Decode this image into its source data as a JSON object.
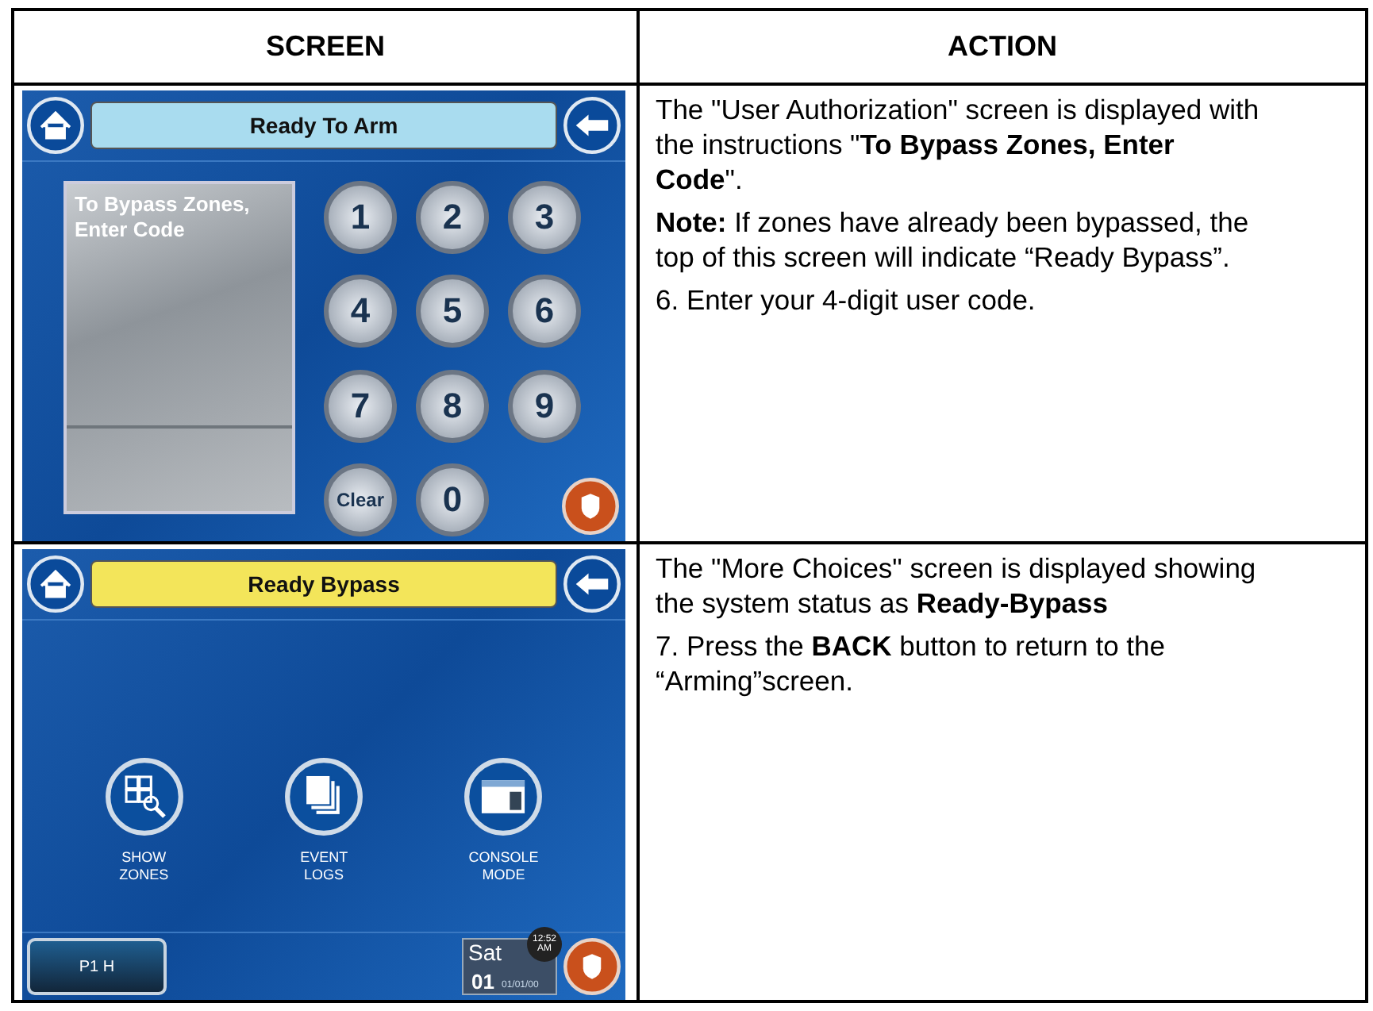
{
  "table": {
    "columns": [
      "SCREEN",
      "ACTION"
    ],
    "rows": [
      {
        "screen": {
          "kind": "keypad",
          "title": "Ready To Arm",
          "bypassed": false,
          "prompt": "To Bypass Zones, Enter Code",
          "keys": [
            "1",
            "2",
            "3",
            "4",
            "5",
            "6",
            "7",
            "8",
            "9",
            "Clear",
            "0"
          ]
        },
        "action": [
          "The \"User Authorization\" screen is displayed with the instructions \"**To Bypass Zones, Enter Code**\".",
          "**Note:** If zones have already been bypassed, the top of this screen will indicate “Ready Bypass”.",
          "6.  Enter your 4-digit user code."
        ]
      },
      {
        "screen": {
          "kind": "menu",
          "title": "Ready Bypass",
          "bypassed": true,
          "options": [
            {
              "kind": "zones",
              "label": "SHOW ZONES"
            },
            {
              "kind": "logs",
              "label": "EVENT LOGS"
            },
            {
              "kind": "console",
              "label": "CONSOLE MODE"
            }
          ],
          "partition": "P1 H",
          "day": "Sat",
          "date_num": "01",
          "date": "01/01/00",
          "time": "12:52",
          "ampm": "AM"
        },
        "action": [
          "The \"More Choices\" screen is displayed showing the system status as **Ready-Bypass**",
          "7. Press the **BACK** button to return to the “Arming”screen."
        ]
      }
    ]
  }
}
